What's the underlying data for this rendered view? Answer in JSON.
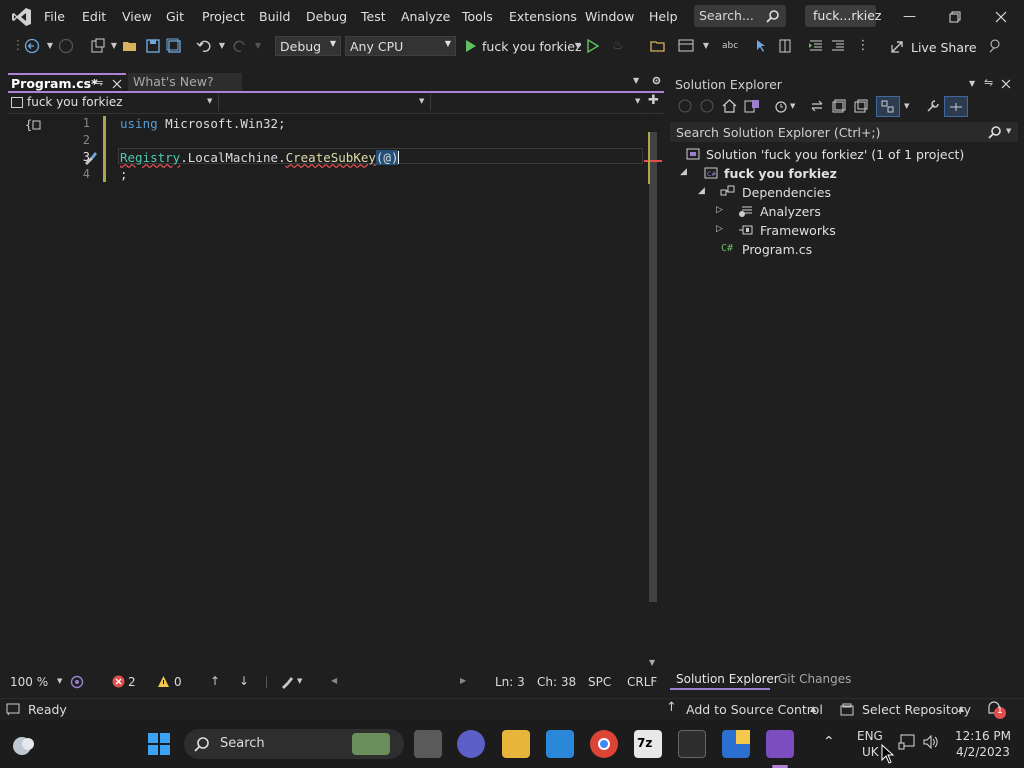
{
  "menu": [
    "File",
    "Edit",
    "View",
    "Git",
    "Project",
    "Build",
    "Debug",
    "Test",
    "Analyze",
    "Tools",
    "Extensions",
    "Window",
    "Help"
  ],
  "search": {
    "label": "Search..."
  },
  "solution_title": "fuck...rkiez",
  "toolbar": {
    "config": "Debug",
    "platform": "Any CPU",
    "run_label": "fuck you forkiez",
    "live_share": "Live Share"
  },
  "tabs": {
    "active": "Program.cs*",
    "inactive": "What's New?"
  },
  "navbar": {
    "project": "fuck you forkiez"
  },
  "editor": {
    "lines": [
      {
        "num": "1",
        "text": "using Microsoft.Win32;"
      },
      {
        "num": "2",
        "text": ""
      },
      {
        "num": "3",
        "text": "Registry.LocalMachine.CreateSubKey(@)"
      },
      {
        "num": "4",
        "text": ";"
      }
    ],
    "token_registry": "Registry",
    "token_dot1": ".",
    "token_localmachine": "LocalMachine",
    "token_dot2": ".",
    "token_createsubkey": "CreateSubKey",
    "token_args": "(@)",
    "token_using": "using",
    "token_ns": " Microsoft.Win32;"
  },
  "editor_status": {
    "zoom": "100 %",
    "errors": "2",
    "warnings": "0",
    "ln": "Ln: 3",
    "ch": "Ch: 38",
    "spc": "SPC",
    "crlf": "CRLF"
  },
  "solution_explorer": {
    "title": "Solution Explorer",
    "search_placeholder": "Search Solution Explorer (Ctrl+;)",
    "solution": "Solution 'fuck you forkiez' (1 of 1 project)",
    "project": "fuck you forkiez",
    "dependencies": "Dependencies",
    "analyzers": "Analyzers",
    "frameworks": "Frameworks",
    "program": "Program.cs",
    "tab_se": "Solution Explorer",
    "tab_git": "Git Changes"
  },
  "statusbar": {
    "ready": "Ready",
    "source_control": "Add to Source Control",
    "select_repo": "Select Repository",
    "notifications": "1"
  },
  "taskbar": {
    "search": "Search",
    "lang1": "ENG",
    "lang2": "UK",
    "time": "12:16 PM",
    "date": "4/2/2023"
  },
  "colors": {
    "accent": "#b180d7",
    "keyword": "#569cd6",
    "type": "#4ec9b0",
    "method": "#dcdcaa",
    "error": "#e04e4e"
  }
}
